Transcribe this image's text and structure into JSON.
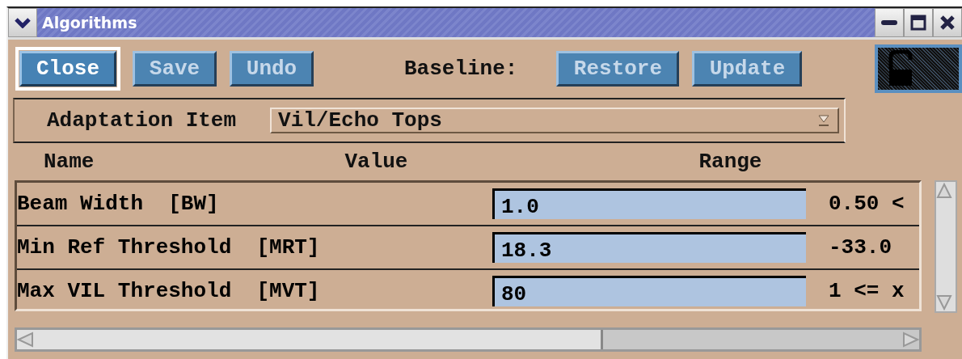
{
  "window": {
    "title": "Algorithms"
  },
  "toolbar": {
    "buttons": [
      {
        "label": "Close",
        "disabled": false
      },
      {
        "label": "Save",
        "disabled": true
      },
      {
        "label": "Undo",
        "disabled": true
      }
    ],
    "baseline_label": "Baseline:",
    "baseline_buttons": [
      {
        "label": "Restore",
        "disabled": true
      },
      {
        "label": "Update",
        "disabled": true
      }
    ]
  },
  "adaptation": {
    "label": "Adaptation Item",
    "value": "Vil/Echo Tops"
  },
  "table": {
    "columns": [
      "Name",
      "Value",
      "Range"
    ],
    "rows": [
      {
        "name": "Beam Width  [BW]",
        "value": "1.0",
        "range": "0.50 <"
      },
      {
        "name": "Min Ref Threshold  [MRT]",
        "value": "18.3",
        "range": "-33.0"
      },
      {
        "name": "Max VIL Threshold  [MVT]",
        "value": "80",
        "range": "1 <= x"
      }
    ]
  }
}
